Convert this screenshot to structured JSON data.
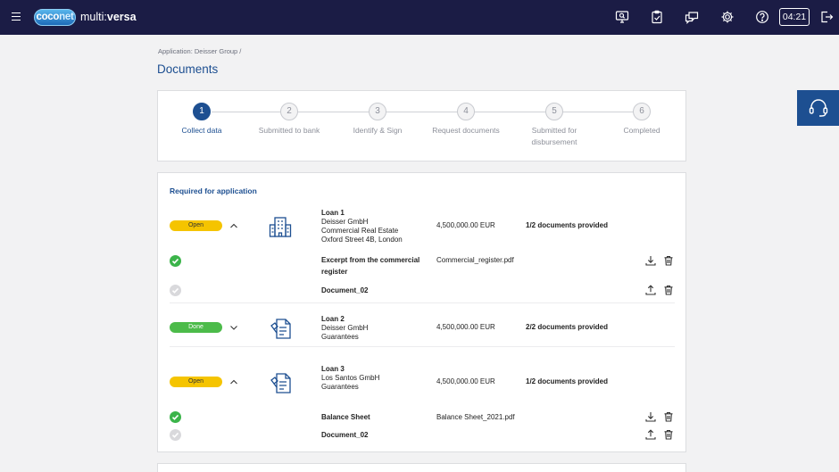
{
  "app": {
    "logo_primary": "coco",
    "logo_secondary": "net",
    "product_prefix": "multi",
    "product_suffix": "versa",
    "session_timer": "04:21"
  },
  "header_icons": [
    "monitor-search-icon",
    "clipboard-check-icon",
    "chat-icon",
    "gear-icon",
    "help-icon",
    "logout-icon"
  ],
  "breadcrumb": "Application: Deisser Group /",
  "page_title": "Documents",
  "steps": [
    {
      "num": "1",
      "label": "Collect data",
      "active": true
    },
    {
      "num": "2",
      "label": "Submitted to bank",
      "active": false
    },
    {
      "num": "3",
      "label": "Identify & Sign",
      "active": false
    },
    {
      "num": "4",
      "label": "Request documents",
      "active": false
    },
    {
      "num": "5",
      "label": "Submitted for disbursement",
      "active": false
    },
    {
      "num": "6",
      "label": "Completed",
      "active": false
    }
  ],
  "section_title": "Required for application",
  "loans": [
    {
      "status": "Open",
      "name": "Loan 1",
      "company": "Deisser GmbH",
      "type": "Commercial Real Estate",
      "address": "Oxford Street 4B, London",
      "amount": "4,500,000.00 EUR",
      "provided": "1/2 documents provided",
      "icon": "building-icon",
      "documents": [
        {
          "name": "Excerpt from the commercial register",
          "file": "Commercial_register.pdf",
          "done": true
        },
        {
          "name": "Document_02",
          "file": "",
          "done": false
        }
      ]
    },
    {
      "status": "Done",
      "name": "Loan 2",
      "company": "Deisser GmbH",
      "type": "Guarantees",
      "address": "",
      "amount": "4,500,000.00 EUR",
      "provided": "2/2 documents provided",
      "icon": "guarantee-document-icon",
      "documents": []
    },
    {
      "status": "Open",
      "name": "Loan 3",
      "company": "Los Santos GmbH",
      "type": "Guarantees",
      "address": "",
      "amount": "4,500,000.00 EUR",
      "provided": "1/2 documents provided",
      "icon": "guarantee-document-icon",
      "documents": [
        {
          "name": "Balance Sheet",
          "file": "Balance Sheet_2021.pdf",
          "done": true
        },
        {
          "name": "Document_02",
          "file": "",
          "done": false
        }
      ]
    }
  ],
  "colors": {
    "topbar": "#1b1c45",
    "accent": "#1d4f91",
    "open": "#f5c400",
    "done": "#4cbb4a"
  }
}
